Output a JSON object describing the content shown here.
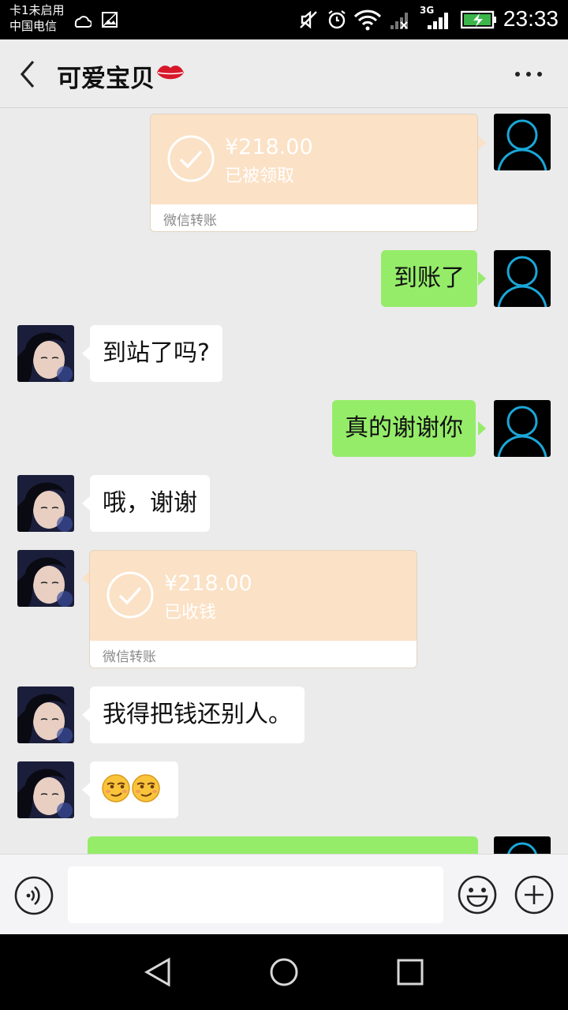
{
  "status_bar": {
    "carrier_line1": "卡1未启用",
    "carrier_line2": "中国电信",
    "network_label": "3G",
    "time": "23:33"
  },
  "header": {
    "title": "可爱宝贝",
    "title_emoji": "lips-icon"
  },
  "messages": [
    {
      "type": "transfer",
      "from": "me",
      "amount": "¥218.00",
      "status": "已被领取",
      "label": "微信转账"
    },
    {
      "type": "text",
      "from": "me",
      "text": "到账了"
    },
    {
      "type": "text",
      "from": "her",
      "text": "到站了吗?"
    },
    {
      "type": "text",
      "from": "me",
      "text": "真的谢谢你"
    },
    {
      "type": "text",
      "from": "her",
      "text": "哦，谢谢"
    },
    {
      "type": "transfer",
      "from": "her",
      "amount": "¥218.00",
      "status": "已收钱",
      "label": "微信转账"
    },
    {
      "type": "text",
      "from": "her",
      "text": "我得把钱还别人。"
    },
    {
      "type": "emoji",
      "from": "her",
      "emojis": [
        "smirk-face-icon",
        "smirk-face-icon"
      ]
    },
    {
      "type": "text",
      "from": "me",
      "text": ""
    }
  ],
  "colors": {
    "my_bubble": "#95ec69",
    "her_bubble": "#ffffff",
    "transfer": "#fbe1c5",
    "avatar_accent": "#1aa7d8"
  }
}
